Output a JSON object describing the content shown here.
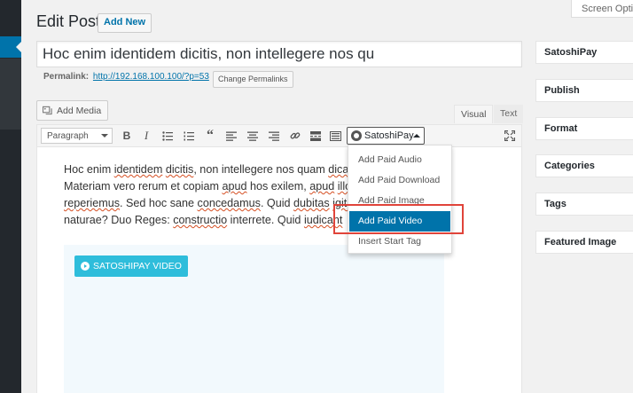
{
  "header": {
    "page_title": "Edit Post",
    "add_new_label": "Add New",
    "screen_options_label": "Screen Options"
  },
  "post": {
    "title_value": "Hoc enim identidem dicitis, non intellegere nos qu",
    "permalink_label": "Permalink:",
    "permalink_url": "http://192.168.100.100/?p=53",
    "change_permalinks_label": "Change Permalinks"
  },
  "media": {
    "add_media_label": "Add Media"
  },
  "editor_tabs": {
    "visual": "Visual",
    "text": "Text"
  },
  "toolbar": {
    "format_select_value": "Paragraph",
    "buttons": [
      "bold-icon",
      "italic-icon",
      "bulleted-list-icon",
      "numbered-list-icon",
      "blockquote-icon",
      "align-left-icon",
      "align-center-icon",
      "align-right-icon",
      "link-icon",
      "read-more-icon",
      "toolbar-toggle-icon",
      "fullscreen-icon"
    ],
    "satoshipay_label": "SatoshiPay"
  },
  "content": {
    "lines": [
      [
        "Hoc enim ",
        "identidem",
        " ",
        "dicitis",
        ", non intellegere nos quam ",
        "dicat",
        ""
      ],
      [
        "Materiam vero rerum et copiam ",
        "apud",
        " hos exilem, ",
        "apud",
        " ",
        "illos",
        ""
      ],
      [
        "",
        "reperiemus",
        ". Sed hoc sane ",
        "concedamus",
        ". Quid ",
        "dubitas",
        " ",
        "igitur",
        ""
      ],
      [
        "naturae? Duo Reges: ",
        "constructio",
        " interrete. Quid ",
        "iudicant",
        ""
      ]
    ],
    "video_button_label": "SATOSHIPAY VIDEO"
  },
  "satoshipay_menu": {
    "items": [
      "Add Paid Audio",
      "Add Paid Download",
      "Add Paid Image",
      "Add Paid Video",
      "Insert Start Tag"
    ],
    "active_index": 3
  },
  "sidebar": {
    "boxes": [
      "SatoshiPay",
      "Publish",
      "Format",
      "Categories",
      "Tags",
      "Featured Image"
    ]
  },
  "colors": {
    "accent": "#0073aa",
    "video_button": "#2ebddb",
    "highlight": "#e0443a",
    "admin_menu": "#23282d"
  }
}
